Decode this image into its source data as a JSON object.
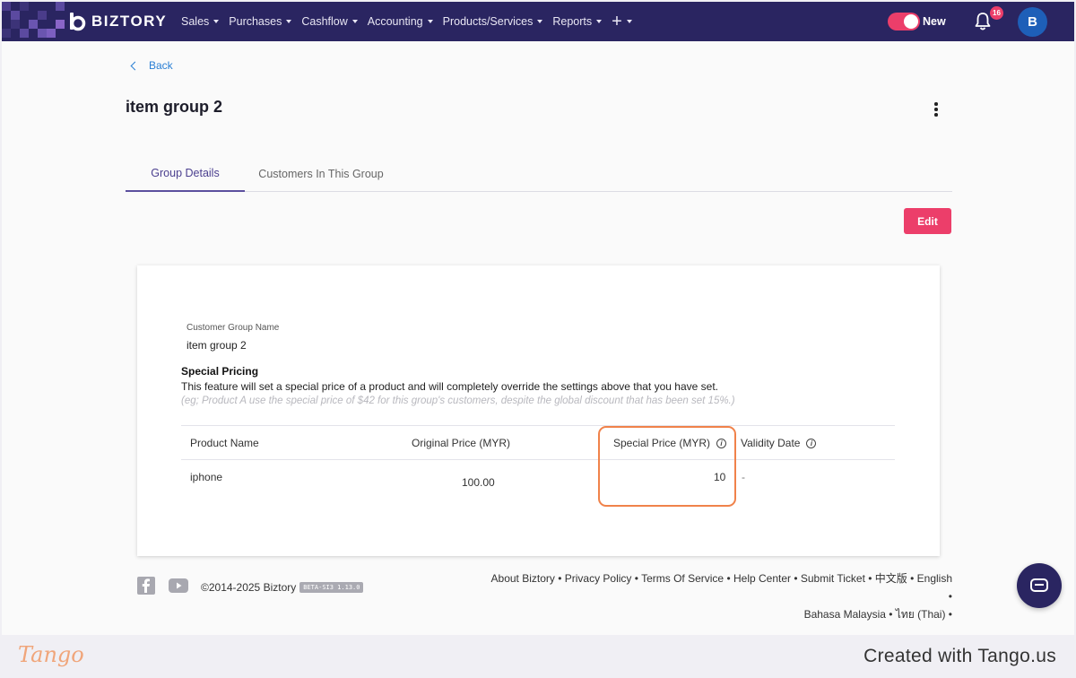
{
  "app": {
    "brand": "BIZTORY",
    "nav": [
      "Sales",
      "Purchases",
      "Cashflow",
      "Accounting",
      "Products/Services",
      "Reports"
    ],
    "plus_icon": "plus-icon",
    "toggle_label": "New",
    "notification_count": "16",
    "avatar_initial": "B",
    "accent_color": "#ec3e6a",
    "nav_color": "#2a2561"
  },
  "page": {
    "back_label": "Back",
    "title": "item group 2",
    "tabs": [
      {
        "label": "Group Details",
        "active": true
      },
      {
        "label": "Customers In This Group",
        "active": false
      }
    ],
    "edit_label": "Edit"
  },
  "details": {
    "group_name_label": "Customer Group Name",
    "group_name_value": "item group 2",
    "special_pricing_title": "Special Pricing",
    "special_pricing_desc": "This feature will set a special price of a product and will completely override the settings above that you have set.",
    "special_pricing_example": "(eg; Product A use the special price of $42 for this group's customers, despite the global discount that has been set 15%.)"
  },
  "table": {
    "headers": [
      "Product Name",
      "Original Price (MYR)",
      "Special Price (MYR)",
      "Validity Date"
    ],
    "rows": [
      {
        "product": "iphone",
        "original_price": "100.00",
        "special_price": "10",
        "validity": "-"
      }
    ]
  },
  "footer": {
    "copyright": "©2014-2025 Biztory",
    "version": "BETA-SI3 1.13.0",
    "links_line1": "About Biztory • Privacy Policy • Terms Of Service • Help Center • Submit Ticket • 中文版 • English •",
    "links_line2": "Bahasa Malaysia • ไทย (Thai) •"
  },
  "tango": {
    "logo": "Tango",
    "created": "Created with Tango.us"
  }
}
